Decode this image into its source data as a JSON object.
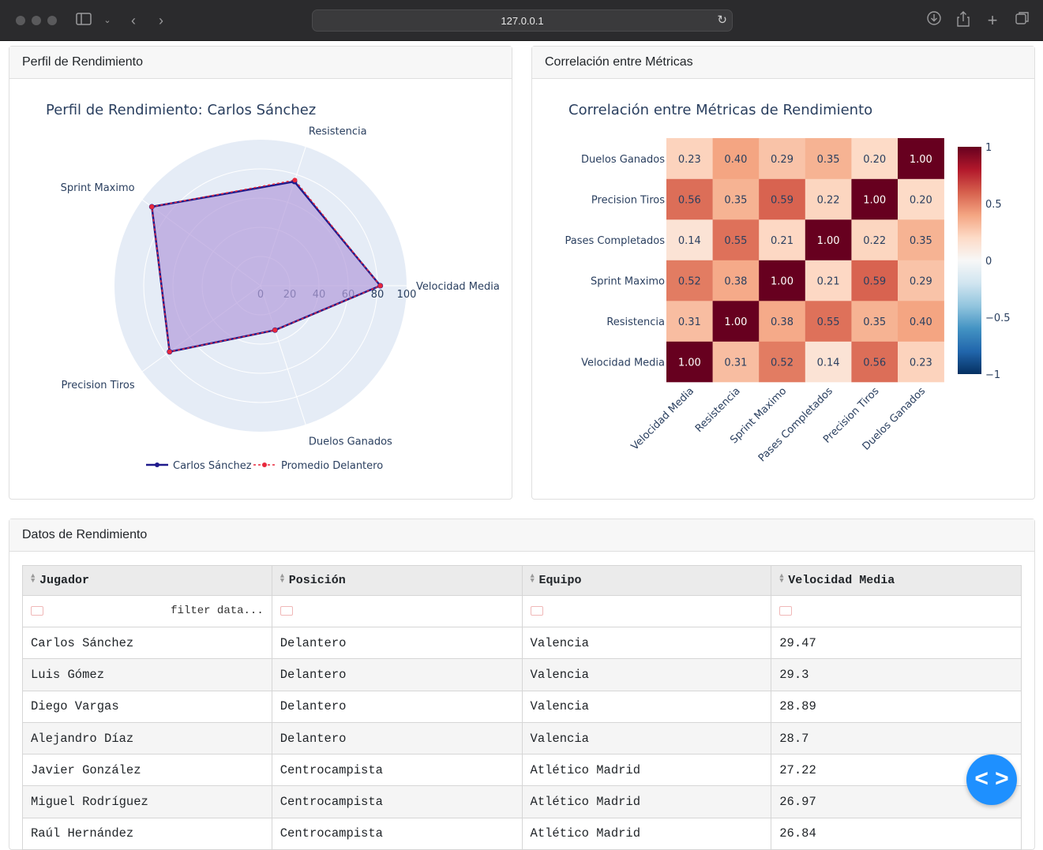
{
  "browser": {
    "url": "127.0.0.1"
  },
  "cards": {
    "radar_header": "Perfil de Rendimiento",
    "heatmap_header": "Correlación entre Métricas",
    "table_header": "Datos de Rendimiento"
  },
  "radar": {
    "title": "Perfil de Rendimiento: Carlos Sánchez",
    "axes": [
      "Velocidad Media",
      "Resistencia",
      "Sprint Maximo",
      "Precision Tiros",
      "Duelos Ganados"
    ],
    "radial_ticks": [
      "0",
      "20",
      "40",
      "60",
      "80",
      "100"
    ],
    "legend": [
      "Carlos Sánchez",
      "Promedio Delantero"
    ],
    "colors": {
      "player": "#1f1a8c",
      "average": "#e8283c",
      "fill": "#b39ddb",
      "bg": "#e5ecf6"
    }
  },
  "heatmap": {
    "title": "Correlación entre Métricas de Rendimiento",
    "labels": [
      "Velocidad Media",
      "Resistencia",
      "Sprint Maximo",
      "Pases Completados",
      "Precision Tiros",
      "Duelos Ganados"
    ],
    "colorbar_ticks": [
      "1",
      "0.5",
      "0",
      "−0.5",
      "−1"
    ]
  },
  "chart_data": [
    {
      "type": "radar",
      "title": "Perfil de Rendimiento: Carlos Sánchez",
      "categories": [
        "Velocidad Media",
        "Resistencia",
        "Sprint Maximo",
        "Precision Tiros",
        "Duelos Ganados"
      ],
      "range": [
        0,
        100
      ],
      "series": [
        {
          "name": "Carlos Sánchez",
          "values": [
            82,
            75,
            92,
            77,
            32
          ]
        },
        {
          "name": "Promedio Delantero",
          "values": [
            82,
            76,
            92,
            77,
            32
          ]
        }
      ]
    },
    {
      "type": "heatmap",
      "title": "Correlación entre Métricas de Rendimiento",
      "x": [
        "Velocidad Media",
        "Resistencia",
        "Sprint Maximo",
        "Pases Completados",
        "Precision Tiros",
        "Duelos Ganados"
      ],
      "y": [
        "Velocidad Media",
        "Resistencia",
        "Sprint Maximo",
        "Pases Completados",
        "Precision Tiros",
        "Duelos Ganados"
      ],
      "z": [
        [
          "1.00",
          "0.31",
          "0.52",
          "0.14",
          "0.56",
          "0.23"
        ],
        [
          "0.31",
          "1.00",
          "0.38",
          "0.55",
          "0.35",
          "0.40"
        ],
        [
          "0.52",
          "0.38",
          "1.00",
          "0.21",
          "0.59",
          "0.29"
        ],
        [
          "0.14",
          "0.55",
          "0.21",
          "1.00",
          "0.22",
          "0.35"
        ],
        [
          "0.56",
          "0.35",
          "0.59",
          "0.22",
          "1.00",
          "0.20"
        ],
        [
          "0.23",
          "0.40",
          "0.29",
          "0.35",
          "0.20",
          "1.00"
        ]
      ],
      "zrange": [
        -1,
        1
      ],
      "colorscale": "RdBu"
    }
  ],
  "table": {
    "columns": [
      "Jugador",
      "Posición",
      "Equipo",
      "Velocidad Media"
    ],
    "filter_placeholder": "filter data...",
    "rows": [
      [
        "Carlos Sánchez",
        "Delantero",
        "Valencia",
        "29.47"
      ],
      [
        "Luis Gómez",
        "Delantero",
        "Valencia",
        "29.3"
      ],
      [
        "Diego Vargas",
        "Delantero",
        "Valencia",
        "28.89"
      ],
      [
        "Alejandro Díaz",
        "Delantero",
        "Valencia",
        "28.7"
      ],
      [
        "Javier González",
        "Centrocampista",
        "Atlético Madrid",
        "27.22"
      ],
      [
        "Miguel Rodríguez",
        "Centrocampista",
        "Atlético Madrid",
        "26.97"
      ],
      [
        "Raúl Hernández",
        "Centrocampista",
        "Atlético Madrid",
        "26.84"
      ]
    ]
  },
  "fab": {
    "label": "< >"
  }
}
